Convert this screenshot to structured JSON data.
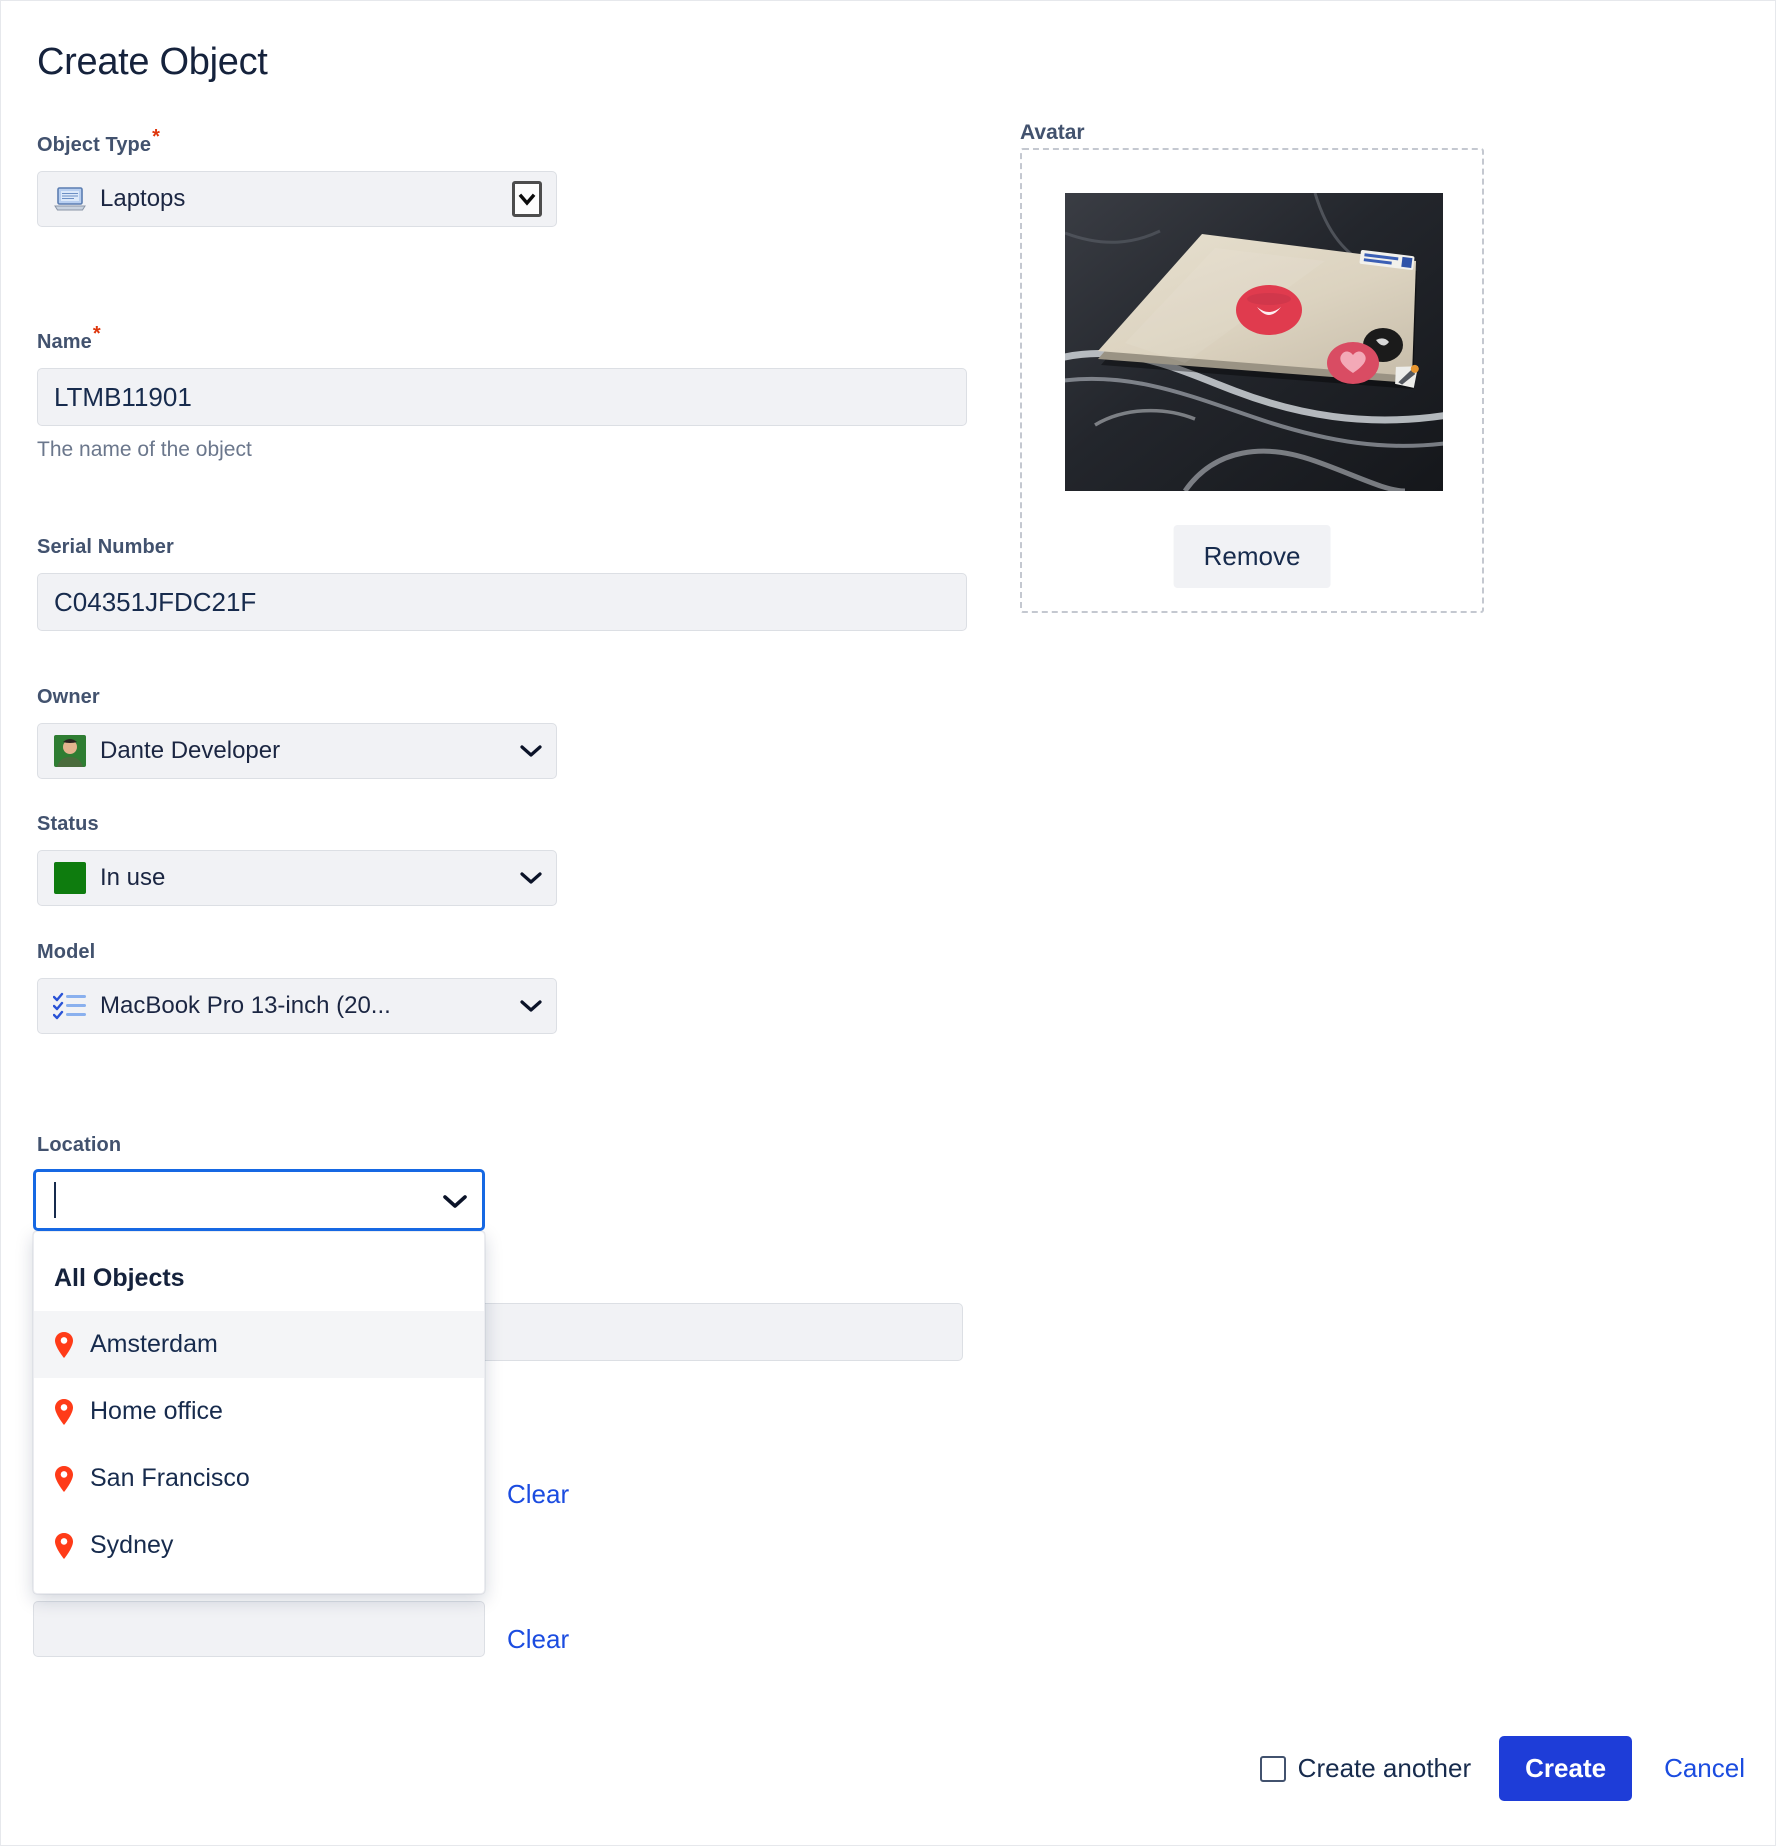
{
  "header": {
    "title": "Create Object"
  },
  "fields": {
    "object_type": {
      "label": "Object Type",
      "required_mark": "*",
      "value": "Laptops",
      "icon": "laptop-icon",
      "control_icon": "boxed-chevron-down-icon"
    },
    "name": {
      "label": "Name",
      "required_mark": "*",
      "value": "LTMB11901",
      "help": "The name of the object",
      "placeholder": ""
    },
    "serial_number": {
      "label": "Serial Number",
      "value": "C04351JFDC21F",
      "placeholder": ""
    },
    "owner": {
      "label": "Owner",
      "value": "Dante Developer",
      "icon": "user-avatar-icon",
      "control_icon": "chevron-down-icon"
    },
    "status": {
      "label": "Status",
      "value": "In use",
      "icon": "status-color-swatch",
      "status_color": "#0E7C0E",
      "control_icon": "chevron-down-icon"
    },
    "model": {
      "label": "Model",
      "value": "MacBook Pro 13-inch (20...",
      "icon": "checklist-icon",
      "control_icon": "chevron-down-icon"
    },
    "location": {
      "label": "Location",
      "value": "",
      "placeholder": "",
      "control_icon": "chevron-down-icon",
      "focused": true
    }
  },
  "location_dropdown": {
    "group_header": "All Objects",
    "options": [
      {
        "label": "Amsterdam",
        "icon": "location-pin-icon",
        "selected": true
      },
      {
        "label": "Home office",
        "icon": "location-pin-icon",
        "selected": false
      },
      {
        "label": "San Francisco",
        "icon": "location-pin-icon",
        "selected": false
      },
      {
        "label": "Sydney",
        "icon": "location-pin-icon",
        "selected": false
      }
    ],
    "pin_color": "#FF3B18"
  },
  "background_fields": {
    "clear_link_1": "Clear",
    "clear_link_2": "Clear"
  },
  "avatar": {
    "label": "Avatar",
    "remove_label": "Remove",
    "image_alt": "laptop-photo"
  },
  "footer": {
    "create_another_label": "Create another",
    "create_another_checked": false,
    "create_label": "Create",
    "cancel_label": "Cancel",
    "primary_color": "#1E3DD8",
    "link_color": "#1B4CE0"
  }
}
